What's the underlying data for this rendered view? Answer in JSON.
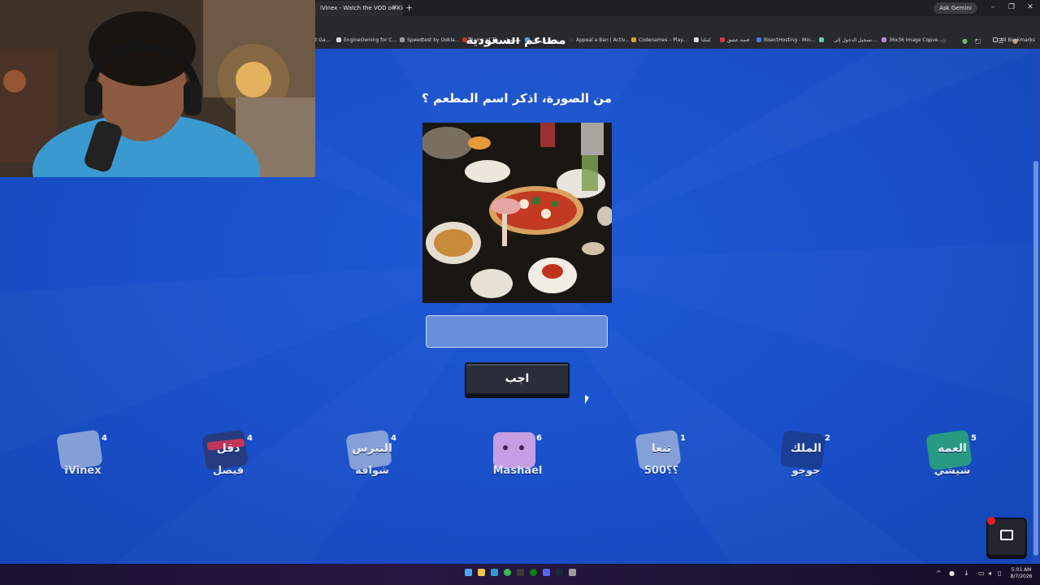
{
  "browser": {
    "tab_title": "iVinex - Watch the VOD on Kick",
    "close_glyph": "✕",
    "new_tab_glyph": "+",
    "ask_gemini": "Ask Gemini",
    "minimize": "–",
    "maximize": "❐",
    "close": "✕",
    "bookmarks": [
      {
        "label": "t Ga..."
      },
      {
        "label": "EngineOwning for C..."
      },
      {
        "label": "Speedtest by Ookla..."
      },
      {
        "label": "Game of Th... مسلسل"
      },
      {
        "label": "ريسورس باك"
      },
      {
        "label": "Appeal a Ban | Activ..."
      },
      {
        "label": "Codenames – Play..."
      },
      {
        "label": "كملنا"
      },
      {
        "label": "قصة عشق"
      },
      {
        "label": "BisectHosting - Min..."
      },
      {
        "label": ""
      },
      {
        "label": "تسجيل الدخول إلى..."
      },
      {
        "label": "36x36 Image Conve..."
      }
    ],
    "all_bookmarks": "All Bookmarks",
    "more_glyph": "»"
  },
  "game": {
    "category_title": "مطاعم السعودية",
    "question": "من الصورة، اذكر اسم المطعم ؟",
    "image_alt": "restaurant-photo",
    "answer_value": "",
    "answer_placeholder": "",
    "submit_label": "اجب"
  },
  "players": [
    {
      "word": "",
      "name": "iVinex",
      "score": "4",
      "color": "#8fa8d8"
    },
    {
      "word": "دقل",
      "name": "فيصل",
      "score": "4",
      "color": "#c0365b"
    },
    {
      "word": "النيرس",
      "name": "شواقه",
      "score": "4",
      "color": "#8fa8d8"
    },
    {
      "word": "",
      "name": "Mashael",
      "score": "6",
      "color": "#d9a6e6"
    },
    {
      "word": "تنغا",
      "name": "500؟؟",
      "score": "1",
      "color": "#8fa8d8"
    },
    {
      "word": "الملك",
      "name": "جوجو",
      "score": "2",
      "color": "#1b3d8f"
    },
    {
      "word": "العمه",
      "name": "شيشي",
      "score": "5",
      "color": "#2aa37a"
    }
  ],
  "taskbar": {
    "time": "5:01 AM",
    "date": "8/7/2026"
  }
}
